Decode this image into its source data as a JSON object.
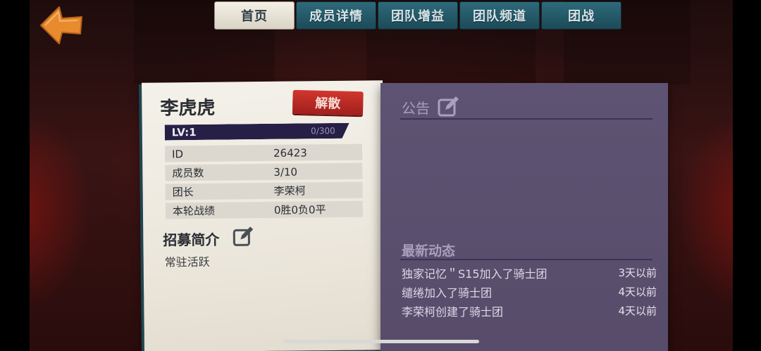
{
  "nav": {
    "back_icon": "back-arrow-icon",
    "tabs": [
      {
        "label": "首页",
        "active": true
      },
      {
        "label": "成员详情",
        "active": false
      },
      {
        "label": "团队增益",
        "active": false
      },
      {
        "label": "团队频道",
        "active": false
      },
      {
        "label": "团战",
        "active": false
      }
    ]
  },
  "team": {
    "name": "李虎虎",
    "disband_label": "解散",
    "level_label": "LV:1",
    "exp": "0/300",
    "info": [
      {
        "key": "ID",
        "value": "26423"
      },
      {
        "key": "成员数",
        "value": "3/10"
      },
      {
        "key": "团长",
        "value": "李荣柯"
      },
      {
        "key": "本轮战绩",
        "value": "0胜0负0平"
      }
    ],
    "recruit_title": "招募简介",
    "recruit_text": "常驻活跃"
  },
  "board": {
    "notice_title": "公告",
    "news_title": "最新动态",
    "news": [
      {
        "text": "独家记忆＂S15加入了骑士团",
        "time": "3天以前"
      },
      {
        "text": "缱绻加入了骑士团",
        "time": "4天以前"
      },
      {
        "text": "李荣柯创建了骑士团",
        "time": "4天以前"
      }
    ]
  },
  "colors": {
    "accent_orange": "#e88a2e",
    "tab_teal": "#2e6a7a",
    "disband_red": "#c02c26",
    "panel_purple": "#5a4f6e"
  }
}
